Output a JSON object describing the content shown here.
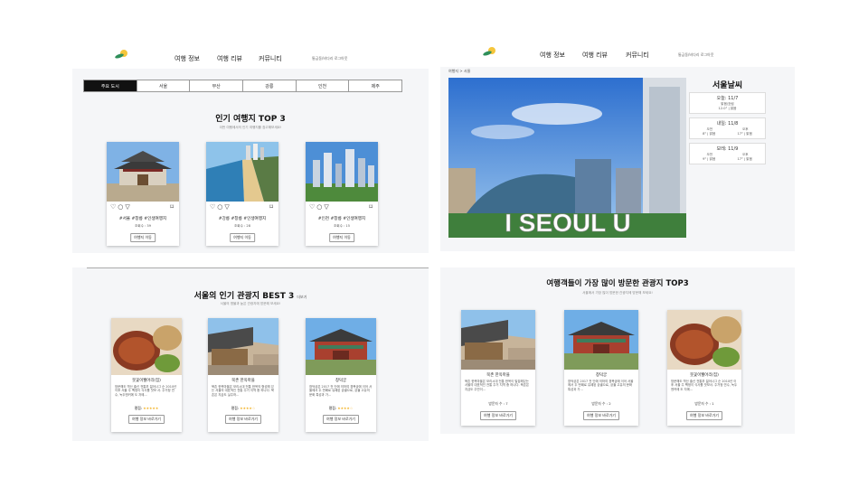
{
  "nav": {
    "logo_text": "여행지 정보",
    "items": [
      "여행 정보",
      "여행 리뷰",
      "커뮤니티"
    ],
    "user_text": "통금동/비다리 로그아웃",
    "user_short": "로그아웃"
  },
  "panel1": {
    "tabs": [
      "주요 도시",
      "서울",
      "부산",
      "강릉",
      "인천",
      "제주"
    ],
    "active_tab": 0,
    "title": "인기 여행지 TOP 3",
    "subtitle": "이번 여행에서의 인기 여행지를 참고해보세요!",
    "cards": [
      {
        "tags": "#서울 #창릉 #인생여행지",
        "views": "조회수 : 39",
        "button": "여행지 이동"
      },
      {
        "tags": "#강릉 #창릉 #인생여행지",
        "views": "조회수 : 28",
        "button": "여행지 이동"
      },
      {
        "tags": "#인천 #창릉 #인생여행지",
        "views": "조회수 : 15",
        "button": "여행지 이동"
      }
    ]
  },
  "panel2": {
    "breadcrumb": "여행지 > 서울",
    "weather_title": "서울날씨",
    "weather": [
      {
        "date": "오늘: 11/7",
        "type": "today",
        "cond": "맑음/흐림",
        "temp": "12.0° | 맑음"
      },
      {
        "date": "내일: 11/8",
        "type": "split",
        "am_label": "오전",
        "pm_label": "오후",
        "am": "8° | 맑음",
        "pm": "17° | 맑음"
      },
      {
        "date": "모레: 11/9",
        "type": "split",
        "am_label": "오전",
        "pm_label": "오후",
        "am": "9° | 맑음",
        "pm": "17° | 맑음"
      }
    ],
    "sign_text": "I SEOUL U"
  },
  "panel3": {
    "title": "서울의 인기 관광지 BEST 3",
    "title_suffix": "더보기",
    "subtitle": "서울의 명물과 높은 관광지에 방문해 보세요!",
    "cards": [
      {
        "name": "붓꽃이웰어리(집)",
        "desc": "방문해도 역산 출신 전통부 젊어나그 순 2010년 이후 서울 주 팩정이 식사를 맛보 서. 주거정 연수, 녹두엔커에 도 자에...",
        "rating_label": "평점:",
        "stars": "★★★★★",
        "button": "여행 정보 바로가기"
      },
      {
        "name": "북촌 한옥마을",
        "desc": "북촌 한옥마을은 모리시대 전통 한옥의 형성해 있는 서울의 대표적인 전통 주거 지역 중 하나다. 북촌은 지금도 실주하...",
        "rating_label": "평점:",
        "stars": "★★★★☆",
        "button": "여행 정보 바로가기"
      },
      {
        "name": "창덕궁",
        "desc": "창덕궁은 2017 전 단에 의하여 경복궁에 이어 서울에서 두 번째로 유례된 궁궐으로, 궁궐 고유의 문화 특성과 가...",
        "rating_label": "평점:",
        "stars": "★★★★☆",
        "button": "여행 정보 바로가기"
      }
    ]
  },
  "panel4": {
    "title": "여행객들이 가장 많이 방문한 관광지 TOP3",
    "subtitle": "서울에서 가장 많이 방문한 관광지에 방문해 보세요!",
    "cards": [
      {
        "name": "북촌 한옥마을",
        "desc": "북촌 한옥마을은 모리시대 전통 한옥이 밀집해있는 서울의 대표적인 전통 주거 지역 중 하나다. 북촌은 지금도 주민이...",
        "visits": "방문자 수 : 7",
        "button": "여행 정보 바로가기"
      },
      {
        "name": "창덕궁",
        "desc": "창덕궁은 2017 전 단에 의하여 경복궁에 이어 서울에서 두 번째로 유례된 궁궐으로, 궁궐 고유의 문화 특성과 가...",
        "visits": "방문자 수 : 2",
        "button": "여행 정보 바로가기"
      },
      {
        "name": "붓꽃이웰어리(집)",
        "desc": "방문해도 역산 출신 전통부 젊어나그 순 2010년 이후 서울 주 팩정이 식사를 맛보서. 주거정 연수, 녹두엔커에 도 자에...",
        "visits": "방문자 수 : 1",
        "button": "여행 정보 바로가기"
      }
    ]
  },
  "colors": {
    "accent": "#111111",
    "star": "#f2b01e",
    "panel_bg": "#f5f6f8"
  }
}
